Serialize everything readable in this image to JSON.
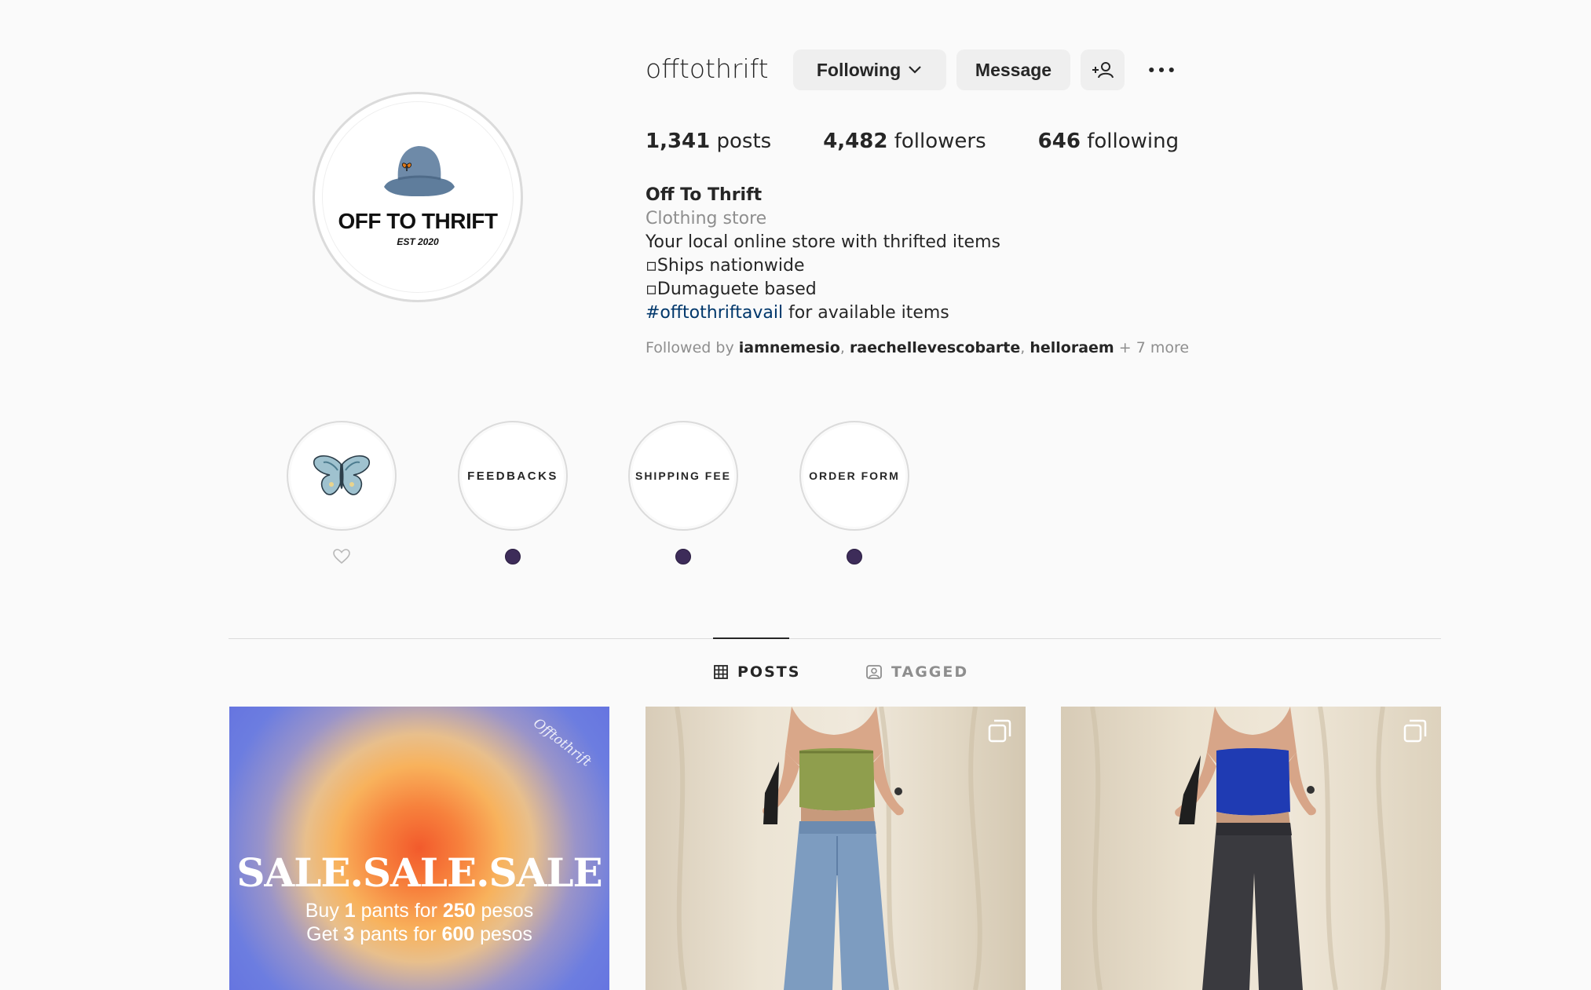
{
  "profile": {
    "username": "offtothrift",
    "avatar_text": "OFF TO THRIFT",
    "avatar_subtext": "EST 2020",
    "following_label": "Following",
    "message_label": "Message",
    "stats": {
      "posts_count": "1,341",
      "posts_label": "posts",
      "followers_count": "4,482",
      "followers_label": "followers",
      "following_count": "646",
      "following_label": "following"
    },
    "bio": {
      "name": "Off To Thrift",
      "category": "Clothing store",
      "line1": "Your local online store with thrifted items",
      "line2": "▫Ships nationwide",
      "line3": "▫Dumaguete based",
      "hashtag": "#offtothriftavail",
      "hashtag_suffix": " for available items"
    },
    "followed_by": {
      "prefix": "Followed by ",
      "user1": "iamnemesio",
      "user2": "raechellevescobarte",
      "user3": "helloraem",
      "more": " + 7 more"
    }
  },
  "highlights": [
    {
      "label": "",
      "icon": "butterfly-icon"
    },
    {
      "label": "FEEDBACKS"
    },
    {
      "label": "SHIPPING FEE"
    },
    {
      "label": "ORDER FORM"
    }
  ],
  "tabs": {
    "posts": "POSTS",
    "tagged": "TAGGED"
  },
  "posts": {
    "post1": {
      "headline": "SALE.SALE.SALE",
      "watermark": "Offtothrift",
      "l1_a": "Buy ",
      "l1_b": "1",
      "l1_c": " pants for ",
      "l1_d": "250",
      "l1_e": " pesos",
      "l2_a": "Get ",
      "l2_b": "3",
      "l2_c": " pants for ",
      "l2_d": "600",
      "l2_e": " pesos"
    }
  },
  "colors": {
    "highlight_dot": "#3d2c59",
    "hashtag": "#00376b",
    "button_bg": "#efefef"
  }
}
